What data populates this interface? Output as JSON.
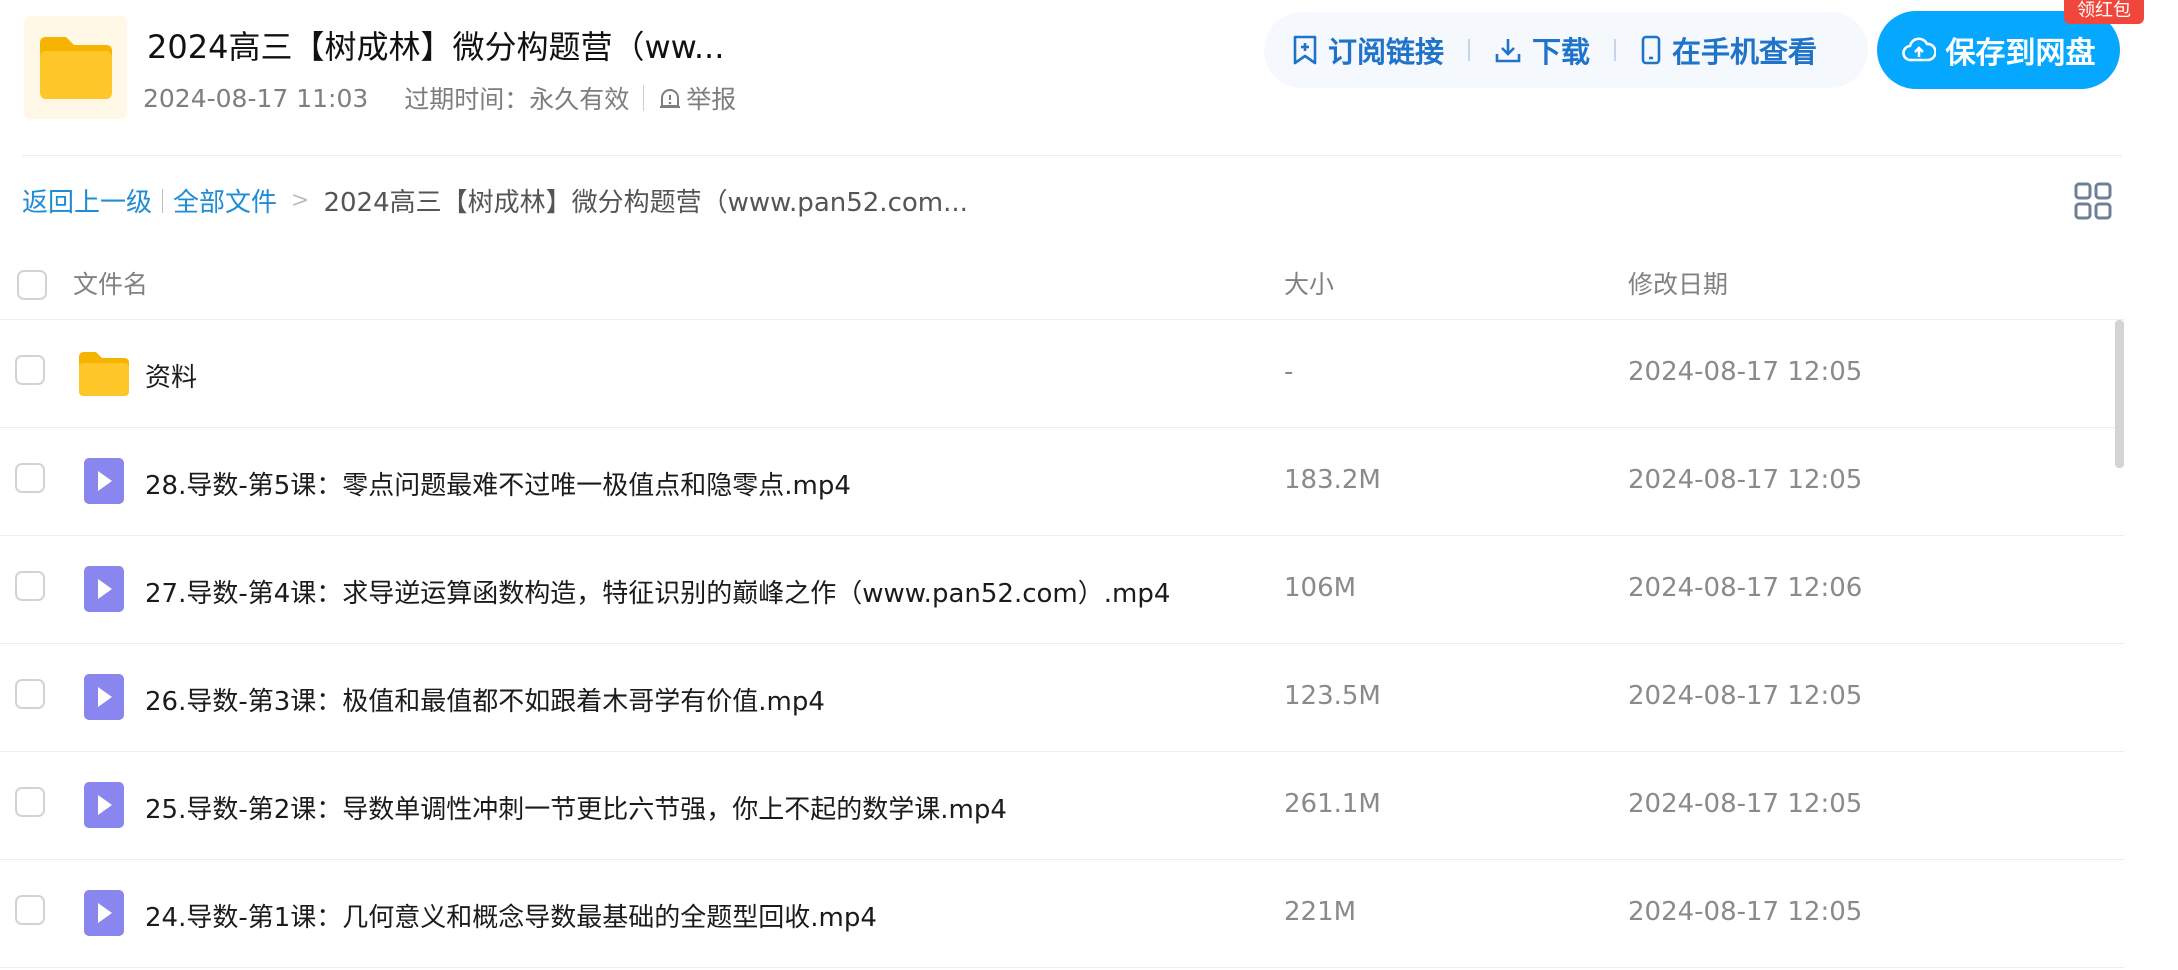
{
  "header": {
    "title": "2024高三【树成林】微分构题营（ww...",
    "created": "2024-08-17 11:03",
    "expiry": "过期时间：永久有效",
    "report": "举报"
  },
  "actions": {
    "subscribe": "订阅链接",
    "download": "下载",
    "phone": "在手机查看",
    "save": "保存到网盘",
    "red_packet": "领红包"
  },
  "breadcrumb": {
    "back": "返回上一级",
    "all_files": "全部文件",
    "arrow": ">",
    "current": "2024高三【树成林】微分构题营（www.pan52.com..."
  },
  "table": {
    "col_name": "文件名",
    "col_size": "大小",
    "col_date": "修改日期",
    "rows": [
      {
        "type": "folder",
        "name": "资料",
        "size": "-",
        "date": "2024-08-17 12:05"
      },
      {
        "type": "video",
        "name": "28.导数-第5课：零点问题最难不过唯一极值点和隐零点.mp4",
        "size": "183.2M",
        "date": "2024-08-17 12:05"
      },
      {
        "type": "video",
        "name": "27.导数-第4课：求导逆运算函数构造，特征识别的巅峰之作（www.pan52.com）.mp4",
        "size": "106M",
        "date": "2024-08-17 12:06"
      },
      {
        "type": "video",
        "name": "26.导数-第3课：极值和最值都不如跟着木哥学有价值.mp4",
        "size": "123.5M",
        "date": "2024-08-17 12:05"
      },
      {
        "type": "video",
        "name": "25.导数-第2课：导数单调性冲刺一节更比六节强，你上不起的数学课.mp4",
        "size": "261.1M",
        "date": "2024-08-17 12:05"
      },
      {
        "type": "video",
        "name": "24.导数-第1课：几何意义和概念导数最基础的全题型回收.mp4",
        "size": "221M",
        "date": "2024-08-17 12:05"
      }
    ]
  },
  "colors": {
    "accent": "#06a7ff",
    "action_text": "#1f73c8",
    "link": "#1f8cd6",
    "folder": "#ffc629",
    "video_icon": "#8a86f0",
    "badge": "#f0463b"
  },
  "icons": {
    "logo": "folder-icon",
    "subscribe": "bookmark-plus-icon",
    "download": "download-icon",
    "phone": "phone-icon",
    "save": "cloud-upload-icon",
    "report": "alert-icon",
    "view_toggle": "grid-view-icon",
    "video": "play-icon"
  }
}
